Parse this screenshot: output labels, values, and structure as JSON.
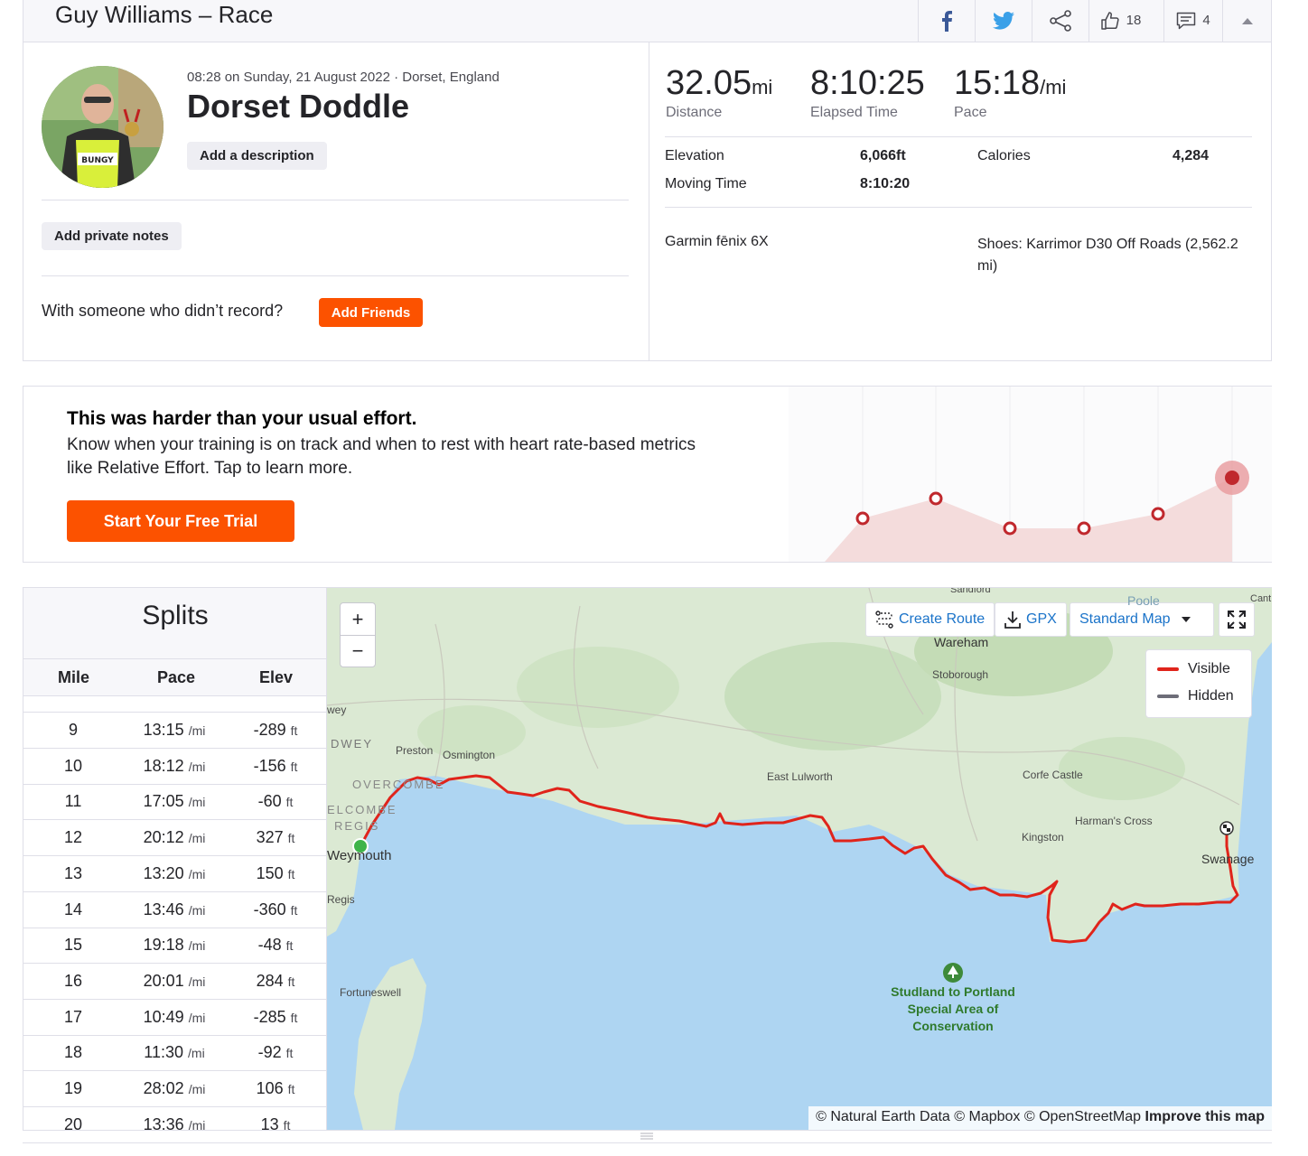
{
  "header": {
    "title": "Guy Williams – Race",
    "kudos_count": "18",
    "comments_count": "4"
  },
  "activity": {
    "meta": "08:28 on Sunday, 21 August 2022 · Dorset, England",
    "name": "Dorset Doddle",
    "add_description_label": "Add a description",
    "add_private_notes_label": "Add private notes",
    "with_someone_text": "With someone who didn’t record?",
    "add_friends_label": "Add Friends"
  },
  "stats": {
    "distance_value": "32.05",
    "distance_unit": "mi",
    "distance_label": "Distance",
    "elapsed_value": "8:10:25",
    "elapsed_label": "Elapsed Time",
    "pace_value": "15:18",
    "pace_unit": "/mi",
    "pace_label": "Pace",
    "elevation_label": "Elevation",
    "elevation_value": "6,066ft",
    "moving_time_label": "Moving Time",
    "moving_time_value": "8:10:20",
    "calories_label": "Calories",
    "calories_value": "4,284",
    "device": "Garmin fēnix 6X",
    "shoes": "Shoes: Karrimor D30 Off Roads (2,562.2 mi)"
  },
  "effort": {
    "heading": "This was harder than your usual effort.",
    "body": "Know when your training is on track and when to rest with heart rate-based metrics like Relative Effort. Tap to learn more.",
    "cta_label": "Start Your Free Trial",
    "accent_color": "#fc5200",
    "point_color": "#c0282d"
  },
  "splits": {
    "title": "Splits",
    "columns": [
      "Mile",
      "Pace",
      "Elev"
    ],
    "pace_unit": "/mi",
    "elev_unit": "ft",
    "rows": [
      {
        "mile": "9",
        "pace": "13:15",
        "elev": "-289"
      },
      {
        "mile": "10",
        "pace": "18:12",
        "elev": "-156"
      },
      {
        "mile": "11",
        "pace": "17:05",
        "elev": "-60"
      },
      {
        "mile": "12",
        "pace": "20:12",
        "elev": "327"
      },
      {
        "mile": "13",
        "pace": "13:20",
        "elev": "150"
      },
      {
        "mile": "14",
        "pace": "13:46",
        "elev": "-360"
      },
      {
        "mile": "15",
        "pace": "19:18",
        "elev": "-48"
      },
      {
        "mile": "16",
        "pace": "20:01",
        "elev": "284"
      },
      {
        "mile": "17",
        "pace": "10:49",
        "elev": "-285"
      },
      {
        "mile": "18",
        "pace": "11:30",
        "elev": "-92"
      },
      {
        "mile": "19",
        "pace": "28:02",
        "elev": "106"
      },
      {
        "mile": "20",
        "pace": "13:36",
        "elev": "13"
      }
    ]
  },
  "map": {
    "zoom_in": "+",
    "zoom_out": "−",
    "create_route_label": "Create Route",
    "gpx_label": "GPX",
    "map_style_label": "Standard Map",
    "legend_visible": "Visible",
    "legend_hidden": "Hidden",
    "route_color": "#e0241b",
    "hidden_color": "#6d6d78",
    "places": {
      "sandford": "Sandford",
      "wareham": "Wareham",
      "stoborough": "Stoborough",
      "preston": "Preston",
      "osmington": "Osmington",
      "overcombe": "OVERCOMBE",
      "elcombe": "ELCOMBE",
      "regis_upper": "REGIS",
      "weymouth": "Weymouth",
      "regis": "Regis",
      "wey": "wey",
      "dwey": "DWEY",
      "east_lulworth": "East Lulworth",
      "corfe_castle": "Corfe Castle",
      "harmans_cross": "Harman's Cross",
      "kingston": "Kingston",
      "swanage": "Swanage",
      "fortuneswell": "Fortuneswell",
      "poole": "Poole",
      "cant": "Cant",
      "conservation_area": [
        "Studland to Portland",
        "Special Area of",
        "Conservation"
      ]
    },
    "attribution": "© Natural Earth Data © Mapbox © OpenStreetMap",
    "improve_label": "Improve this map"
  }
}
